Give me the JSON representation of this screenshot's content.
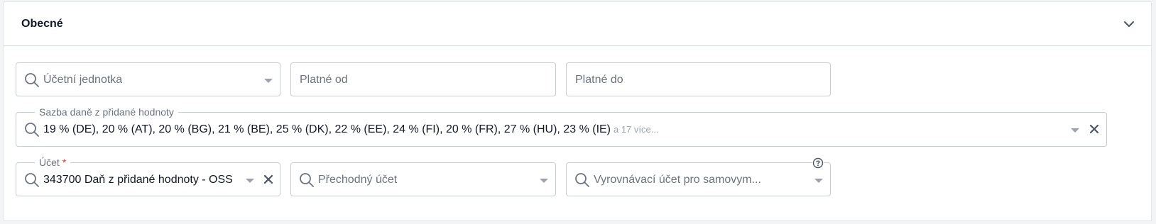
{
  "section": {
    "title": "Obecné"
  },
  "fields": {
    "accounting_unit": {
      "placeholder": "Účetní jednotka"
    },
    "valid_from": {
      "placeholder": "Platné od"
    },
    "valid_to": {
      "placeholder": "Platné do"
    },
    "vat_rate": {
      "label": "Sazba daně z přidané hodnoty",
      "value": "19 % (DE), 20 % (AT), 20 % (BG), 21 % (BE), 25 % (DK), 22 % (EE), 24 % (FI), 20 % (FR), 27 % (HU), 23 % (IE)",
      "more": "a 17 více..."
    },
    "account": {
      "label": "Účet",
      "required_mark": "*",
      "value": "343700 Daň z přidané hodnoty - OSS"
    },
    "transit_account": {
      "placeholder": "Přechodný účet"
    },
    "settlement_account": {
      "placeholder": "Vyrovnávací účet pro samovym..."
    }
  },
  "icons": {
    "search": "search-icon",
    "caret": "caret-down-icon",
    "clear": "close-icon",
    "chevron": "chevron-down-icon",
    "help": "help-circle-icon"
  },
  "colors": {
    "border": "#c9ccd2",
    "placeholder": "#6b7280",
    "required": "#e53935"
  }
}
